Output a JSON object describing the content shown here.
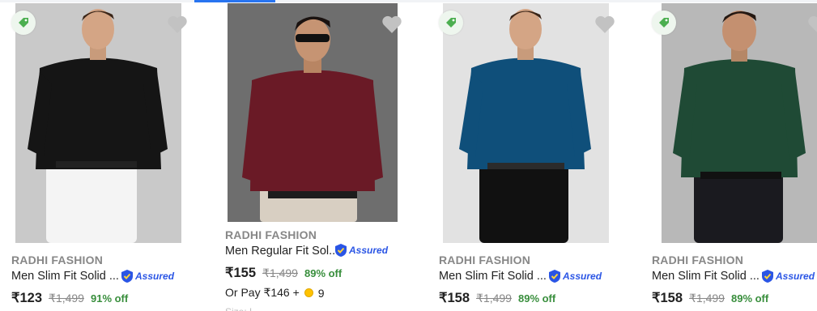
{
  "colors": {
    "accent": "#2874f0",
    "discount_green": "#388e3c",
    "assured_blue": "#2a55e5",
    "muted": "#878787"
  },
  "products": [
    {
      "brand": "RADHI FASHION",
      "title": "Men Slim Fit Solid ...",
      "assured_label": "Assured",
      "price": "₹123",
      "mrp": "₹1,499",
      "discount": "91% off",
      "badge_icon": "price-tag-icon",
      "wishlist_icon": "heart-icon",
      "shirt_color": "#151515",
      "pants_color": "#f4f4f4"
    },
    {
      "brand": "RADHI FASHION",
      "title": "Men Regular Fit Sol...",
      "assured_label": "Assured",
      "price": "₹155",
      "mrp": "₹1,499",
      "discount": "89% off",
      "pay_prefix": "Or Pay ₹146 +",
      "pay_coins": "9",
      "extra_line": "Size: L",
      "wishlist_icon": "heart-icon",
      "shirt_color": "#6a1a26",
      "pants_color": "#d8cfc2"
    },
    {
      "brand": "RADHI FASHION",
      "title": "Men Slim Fit Solid ...",
      "assured_label": "Assured",
      "price": "₹158",
      "mrp": "₹1,499",
      "discount": "89% off",
      "badge_icon": "price-tag-icon",
      "wishlist_icon": "heart-icon",
      "shirt_color": "#0f4f7a",
      "pants_color": "#111111"
    },
    {
      "brand": "RADHI FASHION",
      "title": "Men Slim Fit Solid ...",
      "assured_label": "Assured",
      "price": "₹158",
      "mrp": "₹1,499",
      "discount": "89% off",
      "badge_icon": "price-tag-icon",
      "wishlist_icon": "heart-icon",
      "shirt_color": "#1f4a35",
      "pants_color": "#1a1a1f"
    }
  ]
}
